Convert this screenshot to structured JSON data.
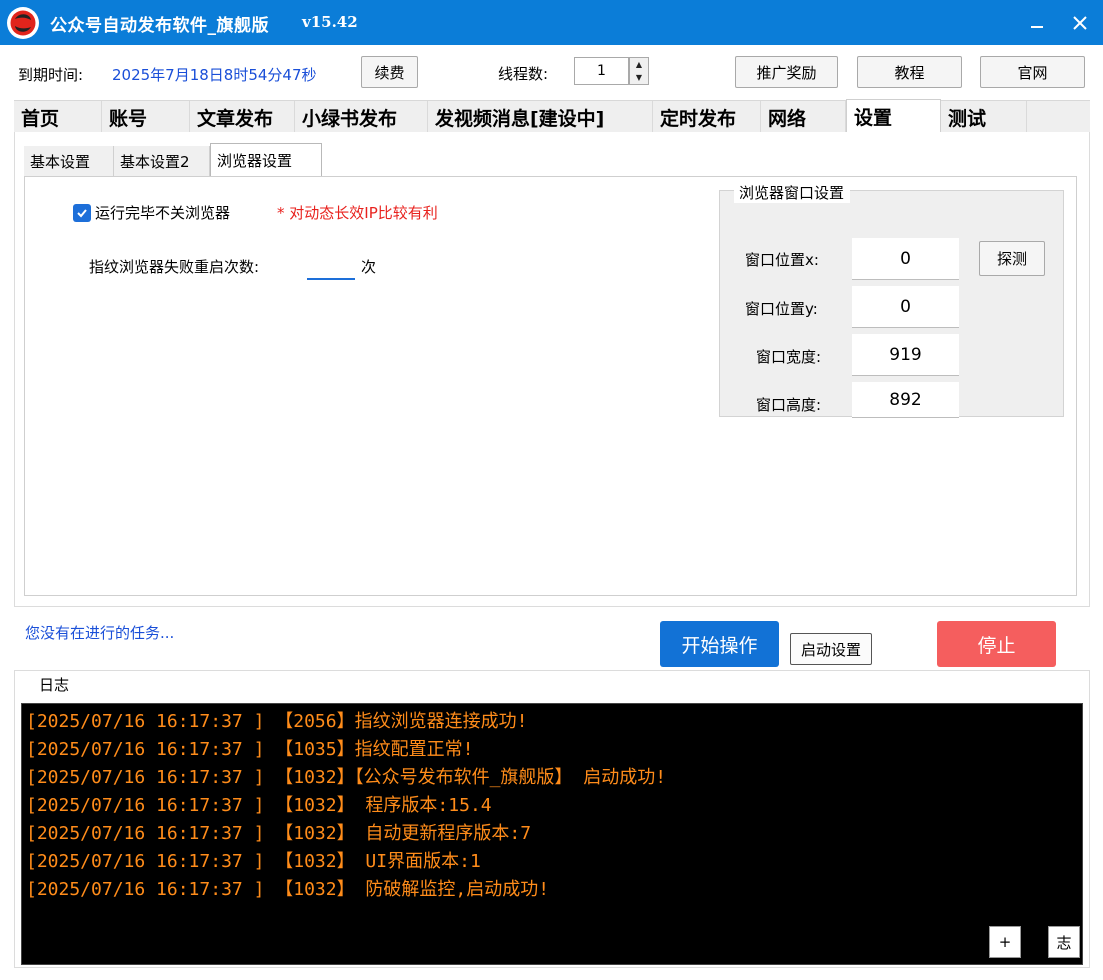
{
  "window": {
    "title": "公众号自动发布软件_旗舰版",
    "version": "v15.42",
    "minimize_glyph": "—",
    "close_glyph": "✕"
  },
  "toolbar": {
    "expire_label": "到期时间:",
    "expire_value": "2025年7月18日8时54分47秒",
    "renew_label": "续费",
    "threads_label": "线程数:",
    "threads_value": "1",
    "promo_label": "推广奖励",
    "tutorial_label": "教程",
    "official_label": "官网"
  },
  "main_tabs": [
    {
      "label": "首页"
    },
    {
      "label": "账号"
    },
    {
      "label": "文章发布"
    },
    {
      "label": "小绿书发布"
    },
    {
      "label": "发视频消息[建设中]"
    },
    {
      "label": "定时发布"
    },
    {
      "label": "网络"
    },
    {
      "label": "设置",
      "active": true
    },
    {
      "label": "测试"
    }
  ],
  "inner_tabs": [
    {
      "label": "基本设置"
    },
    {
      "label": "基本设置2"
    },
    {
      "label": "浏览器设置",
      "active": true
    }
  ],
  "browser_settings": {
    "close_browser_label": "运行完毕不关浏览器",
    "close_browser_checked": true,
    "ip_note": "* 对动态长效IP比较有利",
    "restart_label": "指纹浏览器失败重启次数:",
    "restart_value": "",
    "restart_unit": "次",
    "window_group": {
      "title": "浏览器窗口设置",
      "pos_x_label": "窗口位置x:",
      "pos_x_value": "0",
      "pos_y_label": "窗口位置y:",
      "pos_y_value": "0",
      "width_label": "窗口宽度:",
      "width_value": "919",
      "height_label": "窗口高度:",
      "height_value": "892",
      "detect_label": "探测"
    }
  },
  "status": {
    "text": "您没有在进行的任务..."
  },
  "actions": {
    "start_label": "开始操作",
    "startup_settings_label": "启动设置",
    "stop_label": "停止"
  },
  "log": {
    "title": "日志",
    "lines": [
      "[2025/07/16 16:17:37 ] 【2056】指纹浏览器连接成功!",
      "[2025/07/16 16:17:37 ] 【1035】指纹配置正常!",
      "[2025/07/16 16:17:37 ] 【1032】【公众号发布软件_旗舰版】 启动成功!",
      "[2025/07/16 16:17:37 ] 【1032】 程序版本:15.4",
      "[2025/07/16 16:17:37 ] 【1032】 自动更新程序版本:7",
      "[2025/07/16 16:17:37 ] 【1032】 UI界面版本:1",
      "[2025/07/16 16:17:37 ] 【1032】 防破解监控,启动成功!"
    ],
    "plus_label": "+",
    "note_label": "志"
  },
  "colors": {
    "titlebar": "#0b7dd8",
    "link_blue": "#1a4fd8",
    "note_red": "#e8221e",
    "start_button": "#1272d6",
    "stop_button": "#f55e5e",
    "log_text": "#ff8c1a",
    "log_background": "#000000"
  },
  "icons": {
    "app_logo": "app-logo-icon",
    "checkbox": "checkmark-icon",
    "spin_up": "triangle-up-icon",
    "spin_down": "triangle-down-icon"
  }
}
